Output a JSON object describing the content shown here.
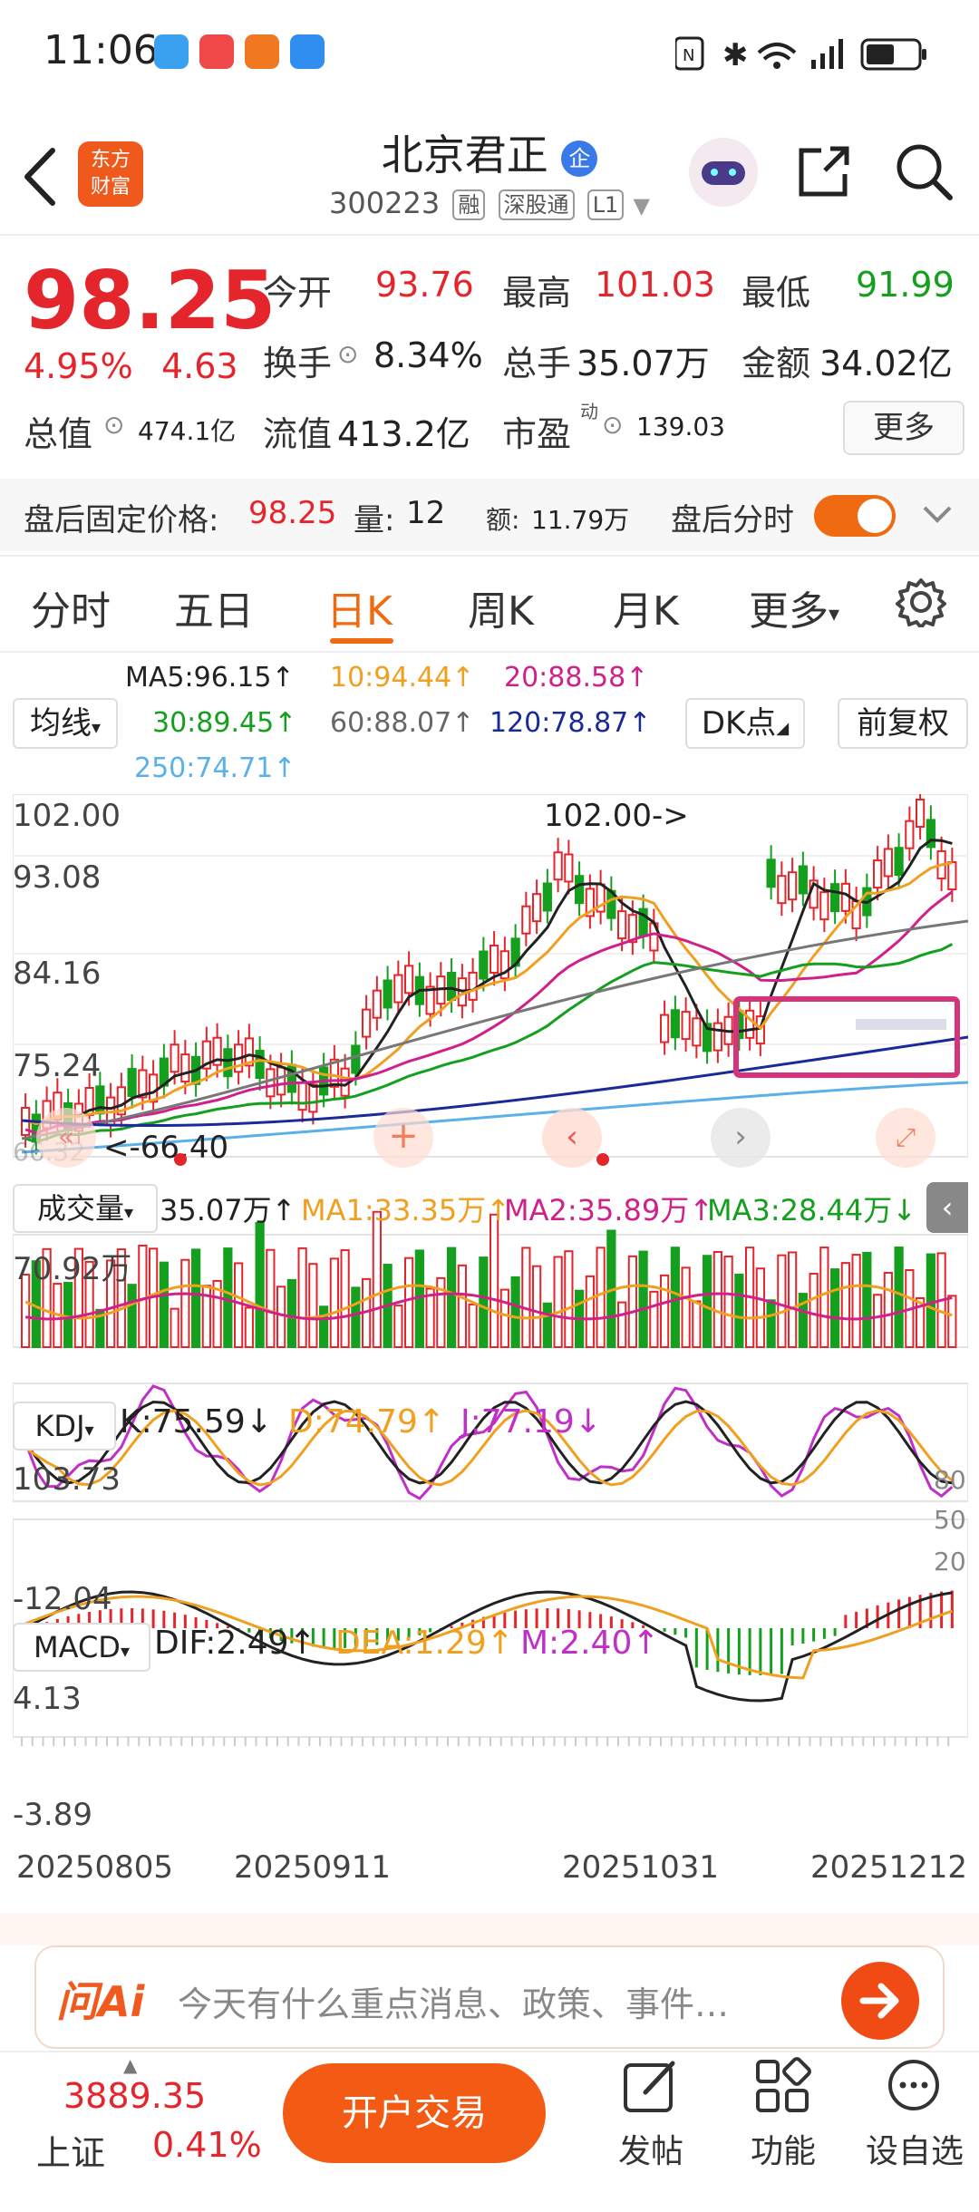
{
  "status_bar": {
    "time": "11:06"
  },
  "header": {
    "title": "北京君正",
    "badge": "企",
    "code": "300223",
    "tags": [
      "融",
      "深股通",
      "L1"
    ]
  },
  "quote": {
    "price": "98.25",
    "change_pct": "4.95%",
    "change_amt": "4.63",
    "fields": [
      {
        "label": "今开",
        "value": "93.76",
        "color": "#e5252c"
      },
      {
        "label": "最高",
        "value": "101.03",
        "color": "#e5252c"
      },
      {
        "label": "最低",
        "value": "91.99",
        "color": "#14a01e"
      },
      {
        "label": "换手",
        "value": "8.34%"
      },
      {
        "label": "总手",
        "value": "35.07万"
      },
      {
        "label": "金额",
        "value": "34.02亿"
      },
      {
        "label": "总值",
        "value": "474.1亿"
      },
      {
        "label": "流值",
        "value": "413.2亿"
      },
      {
        "label": "市盈",
        "value": "139.03",
        "sup": "动"
      }
    ],
    "more_label": "更多"
  },
  "after_hours": {
    "price_label": "盘后固定价格:",
    "price": "98.25",
    "volume_label": "量:",
    "volume": "12",
    "amount_label": "额:",
    "amount": "11.79万",
    "toggle_label": "盘后分时"
  },
  "tabs": [
    "分时",
    "五日",
    "日K",
    "周K",
    "月K",
    "更多"
  ],
  "active_tab": "日K",
  "ma_legend": {
    "selector": "均线",
    "items": [
      {
        "text": "MA5:96.15↑",
        "color": "#222222"
      },
      {
        "text": "10:94.44↑",
        "color": "#f0a020"
      },
      {
        "text": "20:88.58↑",
        "color": "#d0208a"
      },
      {
        "text": "30:89.45↑",
        "color": "#14a01e"
      },
      {
        "text": "60:88.07↑",
        "color": "#666666"
      },
      {
        "text": "120:78.87↑",
        "color": "#1a2a9a"
      },
      {
        "text": "250:74.71↑",
        "color": "#5ab0e8"
      }
    ],
    "dk_button": "DK点",
    "fq_button": "前复权"
  },
  "kline": {
    "price_axis": [
      "102.00",
      "93.08",
      "84.16",
      "75.24",
      "66.40"
    ],
    "high_marker": "102.00->",
    "low_marker": "66.40",
    "faded_axis_label": "66.32"
  },
  "volume": {
    "selector": "成交量",
    "value": "35.07万↑",
    "ma1": "MA1:33.35万↑",
    "ma2": "MA2:35.89万↑",
    "ma3": "MA3:28.44万↓",
    "axis_top": "70.92万"
  },
  "kdj": {
    "selector": "KDJ",
    "k": "K:75.59↓",
    "d": "D:74.79↑",
    "j": "J:77.19↓",
    "axis_top": "103.73",
    "axis_bottom": "-12.04",
    "right_levels": [
      "80",
      "50",
      "20"
    ]
  },
  "macd": {
    "selector": "MACD",
    "dif": "DIF:2.49↑",
    "dea": "DEA:1.29↑",
    "m": "M:2.40↑",
    "axis_top": "4.13",
    "axis_bottom": "-3.89"
  },
  "dates": [
    "20250805",
    "20250911",
    "20251031",
    "20251212"
  ],
  "ai_bar": {
    "brand": "问Ai",
    "placeholder": "今天有什么重点消息、政策、事件…"
  },
  "bottom_bar": {
    "index_value": "3889.35",
    "index_name": "上证",
    "index_change": "0.41%",
    "open_button": "开户交易",
    "actions": [
      "发帖",
      "功能",
      "设自选"
    ]
  },
  "colors": {
    "up": "#e5252c",
    "down": "#14a01e",
    "accent": "#f06a12",
    "highlight_box": "#d6337a"
  }
}
